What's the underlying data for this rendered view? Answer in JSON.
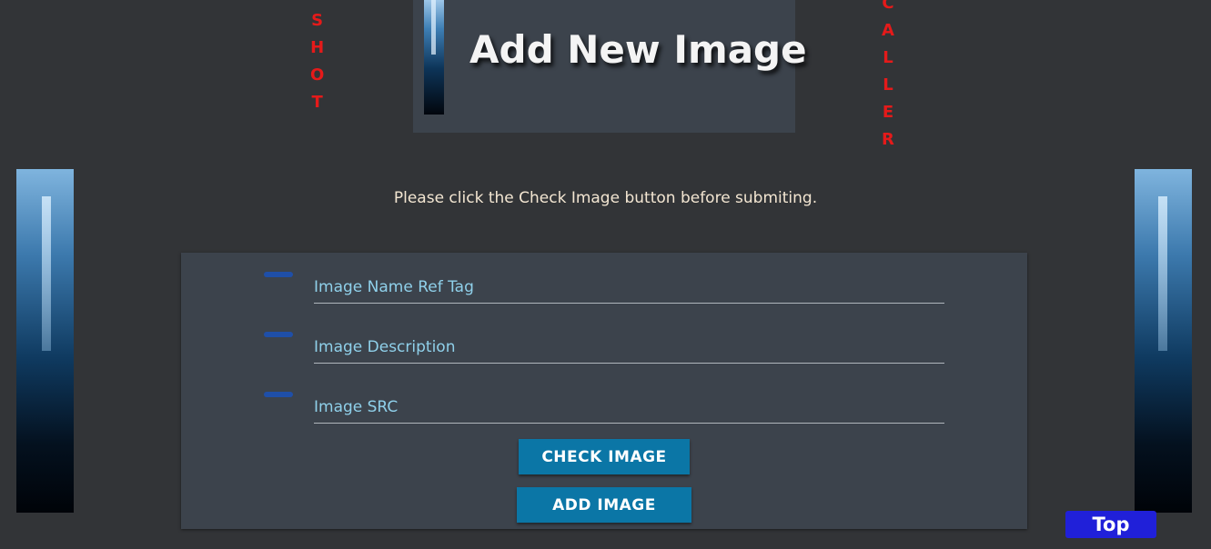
{
  "header": {
    "title": "Add New Image",
    "left_word_letters": [
      "S",
      "H",
      "O",
      "T"
    ],
    "right_word_letters": [
      "C",
      "A",
      "L",
      "L",
      "E",
      "R"
    ]
  },
  "instruction": "Please click the Check Image button before submiting.",
  "form": {
    "fields": [
      {
        "placeholder": "Image Name Ref Tag",
        "value": ""
      },
      {
        "placeholder": "Image Description",
        "value": ""
      },
      {
        "placeholder": "Image SRC",
        "value": ""
      }
    ],
    "check_button_label": "Check Image",
    "add_button_label": "Add Image"
  },
  "top_button_label": "Top",
  "colors": {
    "background": "#323437",
    "panel": "#3c434c",
    "accent_red": "#e51a1a",
    "button_blue": "#0b76a6",
    "top_button_blue": "#2020d9",
    "placeholder_cyan": "#8fd0ea"
  }
}
